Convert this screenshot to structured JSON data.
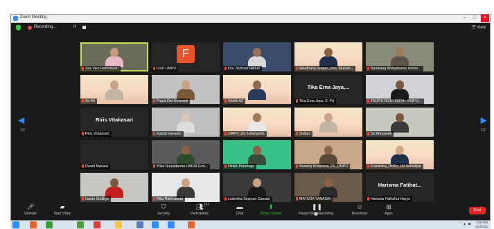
{
  "window": {
    "title": "Zoom Meeting"
  },
  "topbar": {
    "recording_label": "Recording...",
    "pause_glyph": "II",
    "view_label": "View"
  },
  "paging": {
    "left": "1/2",
    "right": "1/2"
  },
  "participants": [
    {
      "name": "Sita Vani Rahmawati",
      "type": "video",
      "speaking": true,
      "skin": "#c99a7e",
      "shirt": "#e9b8c6",
      "bg": "#6a6a58"
    },
    {
      "name": "FKIP UMPO",
      "type": "avatar",
      "initial": "F"
    },
    {
      "name": "Drs. Nurhadi Hanuri",
      "type": "video",
      "skin": "#9a7256",
      "shirt": "#d8d8d8",
      "bg": "#3b4c6a"
    },
    {
      "name": "Wardhana Jeepar_Univ. Muham...",
      "type": "banner",
      "skin": "#8a6244",
      "shirt": "#1f2f4a"
    },
    {
      "name": "Bambang Widyahseno Univer...",
      "type": "video",
      "skin": "#a2785a",
      "shirt": "#5a5248",
      "bg": "#8a8a78"
    },
    {
      "name": "Sri Wi",
      "type": "banner",
      "skin": "#c8a38a",
      "shirt": "#c4b4a4"
    },
    {
      "name": "Puput Dwi Krisnanti",
      "type": "video",
      "skin": "#caa286",
      "shirt": "#7a5a3a",
      "bg": "#c2c2c2"
    },
    {
      "name": "Sholih AZ",
      "type": "banner",
      "skin": "#8e6a4e",
      "shirt": "#2a3a5a"
    },
    {
      "name": "Tika Erna Jaya, S. Pd",
      "type": "name",
      "display": "Tika Erna Jaya,..."
    },
    {
      "name": "TAUFIK RIZKI SISTA - FKIP U...",
      "type": "video",
      "skin": "#7a5840",
      "shirt": "#1a1a1a",
      "bg": "#d0d2d8"
    },
    {
      "name": "Riris Vitakasari",
      "type": "name",
      "display": "Riris Vitakasari"
    },
    {
      "name": "Kukuh Harianto",
      "type": "video",
      "skin": "#d8c8b8",
      "shirt": "#dddddd",
      "bg": "#bfbfbf"
    },
    {
      "name": "UMPO_Uti Suharyanto",
      "type": "banner",
      "skin": "#a07a58",
      "shirt": "#e8e8e8"
    },
    {
      "name": "Sufiani",
      "type": "banner",
      "skin": "#c8a38a",
      "shirt": "#c4b4a4"
    },
    {
      "name": "Sri Wiryaweti",
      "type": "video",
      "skin": "#7a5840",
      "shirt": "#3a3a3a",
      "bg": "#c8c8c0"
    },
    {
      "name": "Dwiati Marsiwi",
      "type": "empty"
    },
    {
      "name": "Yoke Suryadarma UNIDA Gon...",
      "type": "video",
      "skin": "#8a6244",
      "shirt": "#2a4a2a",
      "bg": "#5a5a5a"
    },
    {
      "name": "Dinkik Ponorogo",
      "type": "video",
      "skin": "#8a6244",
      "shirt": "#3a4a3a",
      "bg": "#38c28a"
    },
    {
      "name": "Nanang Kristiyana_FE_UMPO",
      "type": "video",
      "skin": "#8a6244",
      "shirt": "#5a4a3a",
      "bg": "#c9a88a"
    },
    {
      "name": "Fransiska_UMPo_Uti Suhadpar",
      "type": "banner",
      "skin": "#d0a888",
      "shirt": "#1f2f4a"
    },
    {
      "name": "Isanto Sudibyo",
      "type": "video",
      "skin": "#7a5840",
      "shirt": "#c02020",
      "bg": "#c8c6c0"
    },
    {
      "name": "Rika Rahmawati",
      "type": "video",
      "skin": "#c8a38a",
      "shirt": "#3a3a3a",
      "bg": "#e8e8e8"
    },
    {
      "name": "Ludovika Septyan Caesari",
      "type": "video",
      "skin": "#caa286",
      "shirt": "#1a1a1a",
      "bg": "#3a3a3a"
    },
    {
      "name": "MAYUDA YANASIN",
      "type": "video",
      "skin": "#8a6244",
      "shirt": "#2a2a2a",
      "bg": "#6a5a4a"
    },
    {
      "name": "Harisma Fathahul Hayyu",
      "type": "name",
      "display": "Harisma Fatihat..."
    }
  ],
  "toolbar": {
    "unmute": "Unmute",
    "start_video": "Start Video",
    "security": "Security",
    "participants": "Participants",
    "participants_count": "127",
    "chat": "Chat",
    "share_screen": "Share Screen",
    "pause_recording": "Pause/Stop Recording",
    "reactions": "Reactions",
    "apps": "Apps",
    "end": "End"
  },
  "taskbar": {
    "time": "3:03 PM",
    "date": "5/4/2022",
    "app_colors": [
      "#2d8cff",
      "#e8632b",
      "#3a9b3a",
      "#4a9e3a",
      "#d83b3b",
      "#f4c542",
      "#5a7ab8",
      "#2d8cff",
      "#2d8cff",
      "#e8632b"
    ]
  }
}
